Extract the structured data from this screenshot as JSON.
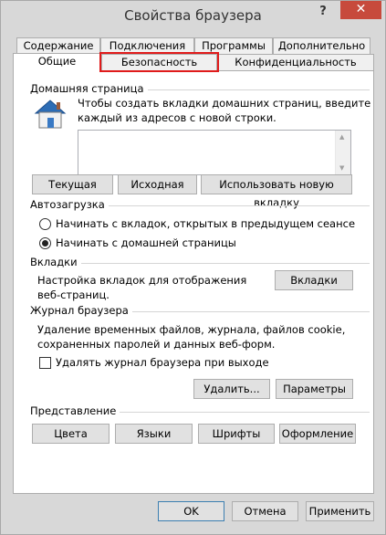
{
  "window": {
    "title": "Свойства браузера",
    "help_label": "?",
    "close_label": "✕"
  },
  "tabs": {
    "row1": [
      "Содержание",
      "Подключения",
      "Программы",
      "Дополнительно"
    ],
    "row2": [
      "Общие",
      "Безопасность",
      "Конфиденциальность"
    ],
    "active": "Общие",
    "highlighted": "Безопасность"
  },
  "home_page": {
    "group_label": "Домашняя страница",
    "instructions_line1": "Чтобы создать вкладки домашних страниц, введите",
    "instructions_line2": "каждый из адресов с новой строки.",
    "addresses_value": "",
    "current_button": "Текущая",
    "original_button": "Исходная",
    "new_tab_button": "Использовать новую вкладку"
  },
  "startup": {
    "group_label": "Автозагрузка",
    "option_tabs": "Начинать с вкладок, открытых в предыдущем сеансе",
    "option_home": "Начинать с домашней страницы",
    "selected": "option_home"
  },
  "tabs_section": {
    "group_label": "Вкладки",
    "description_line1": "Настройка вкладок для отображения",
    "description_line2": "веб-страниц.",
    "button": "Вкладки"
  },
  "history": {
    "group_label": "Журнал браузера",
    "description_line1": "Удаление временных файлов, журнала, файлов cookie,",
    "description_line2": "сохраненных паролей и данных веб-форм.",
    "delete_on_exit_label": "Удалять журнал браузера при выходе",
    "delete_on_exit_checked": false,
    "delete_button": "Удалить...",
    "settings_button": "Параметры"
  },
  "appearance": {
    "group_label": "Представление",
    "colors_button": "Цвета",
    "languages_button": "Языки",
    "fonts_button": "Шрифты",
    "accessibility_button": "Оформление"
  },
  "footer": {
    "ok_button": "OK",
    "cancel_button": "Отмена",
    "apply_button": "Применить"
  },
  "colors": {
    "highlight": "#e01b1b",
    "close_button": "#c74a3c",
    "window_bg": "#d8d8d8"
  }
}
